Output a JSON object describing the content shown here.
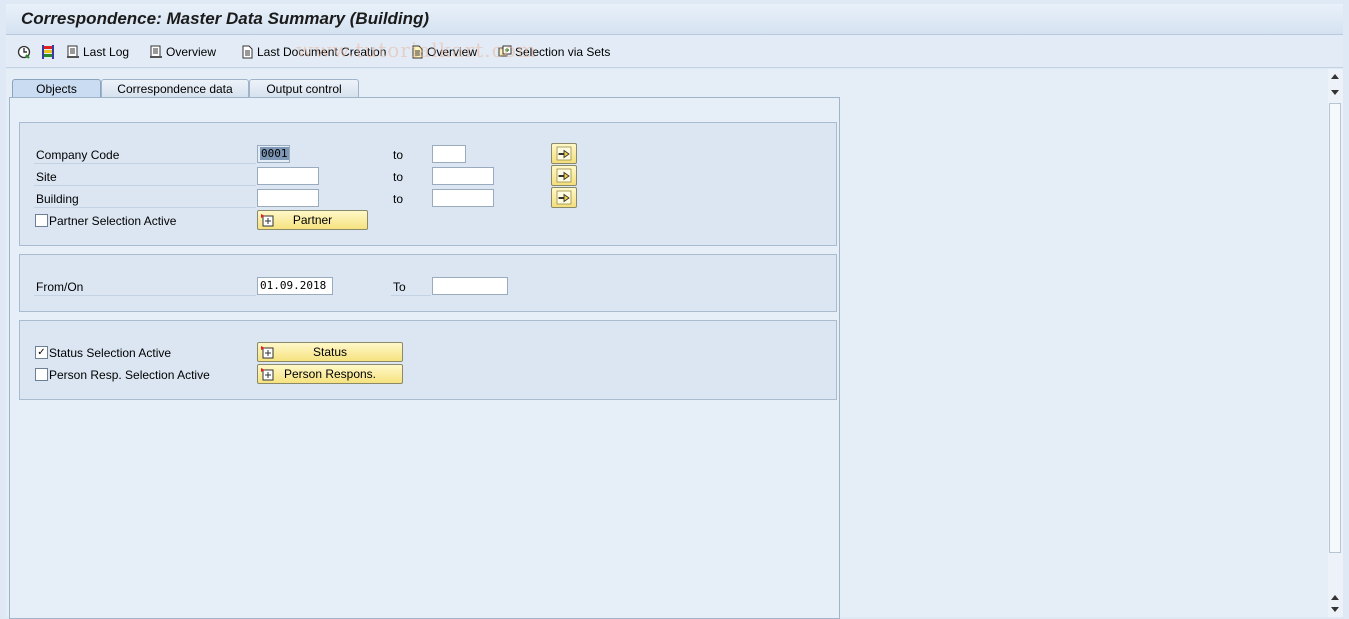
{
  "window": {
    "title": "Correspondence: Master Data Summary (Building)"
  },
  "toolbar": {
    "items": [
      {
        "icon": "execute-icon",
        "label": ""
      },
      {
        "icon": "color-legend-icon",
        "label": ""
      },
      {
        "icon": "last-log-icon",
        "label": "Last Log"
      },
      {
        "icon": "overview-icon",
        "label": "Overview"
      },
      {
        "icon": "document-icon",
        "label": "Last Document Creation"
      },
      {
        "icon": "document-overview-icon",
        "label": "Overview"
      },
      {
        "icon": "selection-sets-icon",
        "label": "Selection via Sets"
      }
    ],
    "watermark": "www.tutorialkart.com"
  },
  "tabs": [
    {
      "label": "Objects",
      "active": true
    },
    {
      "label": "Correspondence data",
      "active": false
    },
    {
      "label": "Output control",
      "active": false
    }
  ],
  "objects": {
    "company_code": {
      "label": "Company Code",
      "from": "0001",
      "to_label": "to",
      "to": ""
    },
    "site": {
      "label": "Site",
      "from": "",
      "to_label": "to",
      "to": ""
    },
    "building": {
      "label": "Building",
      "from": "",
      "to_label": "to",
      "to": ""
    },
    "partner_selection": {
      "label": "Partner Selection Active",
      "checked": false,
      "button": "Partner"
    }
  },
  "dates": {
    "from_label": "From/On",
    "from": "01.09.2018",
    "to_label": "To",
    "to": ""
  },
  "status": {
    "status_selection": {
      "label": "Status Selection Active",
      "checked": true,
      "button": "Status"
    },
    "person_resp_selection": {
      "label": "Person Resp. Selection Active",
      "checked": false,
      "button": "Person Respons."
    }
  },
  "colors": {
    "accent": "#f6e27f",
    "background": "#dfe9f5"
  }
}
